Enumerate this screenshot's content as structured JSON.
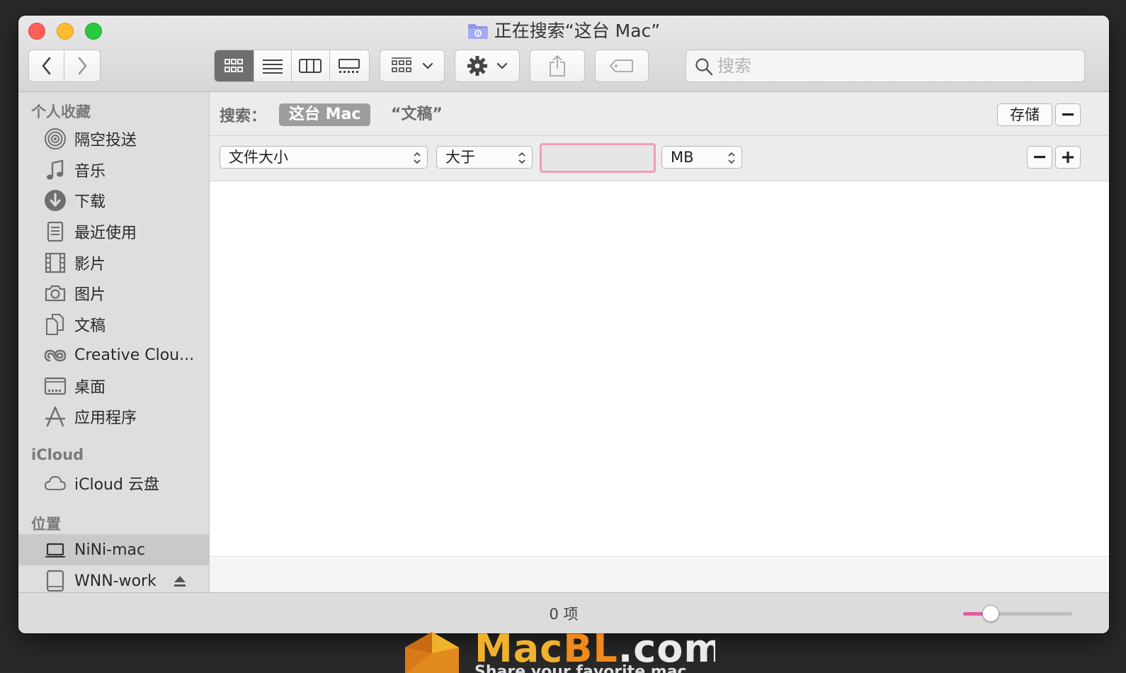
{
  "window": {
    "title": "正在搜索“这台 Mac”"
  },
  "toolbar": {
    "search_placeholder": "搜索"
  },
  "sidebar": {
    "favorites_header": "个人收藏",
    "favorites": [
      {
        "label": "隔空投送",
        "icon": "airdrop-icon"
      },
      {
        "label": "音乐",
        "icon": "music-icon"
      },
      {
        "label": "下载",
        "icon": "download-icon"
      },
      {
        "label": "最近使用",
        "icon": "recents-icon"
      },
      {
        "label": "影片",
        "icon": "movies-icon"
      },
      {
        "label": "图片",
        "icon": "pictures-icon"
      },
      {
        "label": "文稿",
        "icon": "documents-icon"
      },
      {
        "label": "Creative Clou...",
        "icon": "creative-cloud-icon"
      },
      {
        "label": "桌面",
        "icon": "desktop-icon"
      },
      {
        "label": "应用程序",
        "icon": "applications-icon"
      }
    ],
    "icloud_header": "iCloud",
    "icloud": [
      {
        "label": "iCloud 云盘",
        "icon": "icloud-drive-icon"
      }
    ],
    "locations_header": "位置",
    "locations": [
      {
        "label": "NiNi-mac",
        "icon": "laptop-icon",
        "selected": true
      },
      {
        "label": "WNN-work",
        "icon": "drive-icon",
        "ejectable": true
      }
    ]
  },
  "search_scope": {
    "label": "搜索：",
    "this_mac": "这台 Mac",
    "documents": "“文稿”",
    "save": "存储"
  },
  "criteria": {
    "attribute": "文件大小",
    "operator": "大于",
    "value": "",
    "unit": "MB"
  },
  "status": {
    "item_count": "0 项",
    "icon_size_slider": 0.25
  },
  "watermark": {
    "mac": "Mac",
    "bl": "BL",
    "com": ".com",
    "tagline": "Share your favorite mac apps"
  },
  "colors": {
    "accent": "#e35ba1",
    "input_focus": "#ef9dbd"
  }
}
